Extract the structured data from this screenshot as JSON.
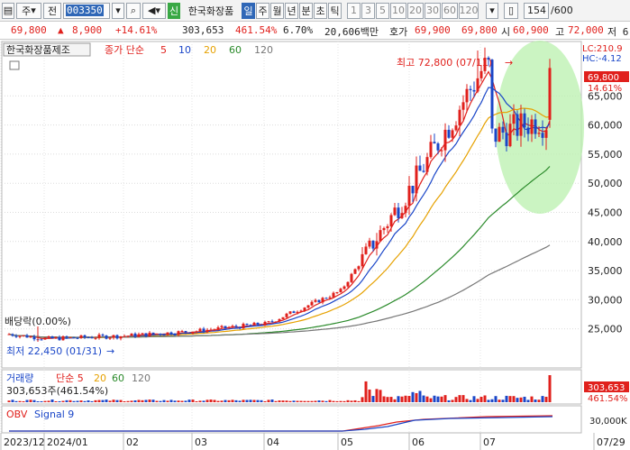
{
  "toolbar": {
    "market": "주",
    "type_btn": "전",
    "code": "003350",
    "new_badge": "신",
    "stock_name": "한국화장품",
    "periods": [
      "일",
      "주",
      "월",
      "년",
      "분",
      "초",
      "틱"
    ],
    "active_period": "일",
    "intervals": [
      "1",
      "3",
      "5",
      "10",
      "20",
      "30",
      "60",
      "120"
    ],
    "count": "154",
    "total": "/600"
  },
  "quote": {
    "price": "69,800",
    "change": "8,900",
    "change_pct": "+14.61%",
    "volume": "303,653",
    "volume_ratio": "461.54%",
    "turnover": "6.70%",
    "amount": "20,606백만",
    "ask_label": "호가",
    "ask": "69,900",
    "bid": "69,800",
    "open_label": "시",
    "open": "60,900",
    "high_label": "고",
    "high": "72,000",
    "extra": "저 6"
  },
  "chart_data": {
    "type": "candlestick",
    "title": "한국화장품제조",
    "ma_label": "종가 단순",
    "ma_periods": [
      "5",
      "10",
      "20",
      "60",
      "120"
    ],
    "ma_colors": [
      "#e0201c",
      "#1a46c8",
      "#e6a100",
      "#2a8a2a",
      "#777777"
    ],
    "x_ticks": [
      "2023/12",
      "2024/01",
      "02",
      "03",
      "04",
      "05",
      "06",
      "07",
      "07/29"
    ],
    "y_ticks": [
      25000,
      30000,
      35000,
      40000,
      45000,
      50000,
      55000,
      60000,
      65000
    ],
    "y_tick_labels": [
      "25,000",
      "30,000",
      "35,000",
      "40,000",
      "45,000",
      "50,000",
      "55,000",
      "60,000",
      "65,000"
    ],
    "ylim": [
      20000,
      72800
    ],
    "last_price": "69,800",
    "last_pct": "14.61%",
    "lc_label": "LC:210.9",
    "hc_label": "HC:-4.12",
    "high_annotation": "최고 72,800 (07/11)",
    "low_annotation": "최저 22,450 (01/31)",
    "dividend_label": "배당락(0.00%)",
    "monthly_closes": [
      {
        "month": "2023/12",
        "close": 24200
      },
      {
        "month": "2024/01",
        "close": 23300
      },
      {
        "month": "02",
        "close": 23800
      },
      {
        "month": "03",
        "close": 24600
      },
      {
        "month": "04",
        "close": 25900
      },
      {
        "month": "05",
        "close": 31500
      },
      {
        "month": "06",
        "close": 49500
      },
      {
        "month": "07",
        "close": 69800
      }
    ],
    "volume_panel": {
      "label": "거래량",
      "ma_label": "단순 5",
      "ma_periods": [
        "20",
        "60",
        "120"
      ],
      "value_text": "303,653주(461.54%)",
      "last_value": "303,653",
      "last_pct": "461.54%"
    },
    "obv_panel": {
      "label": "OBV",
      "signal": "Signal 9",
      "tick_label": "30,000K"
    }
  }
}
